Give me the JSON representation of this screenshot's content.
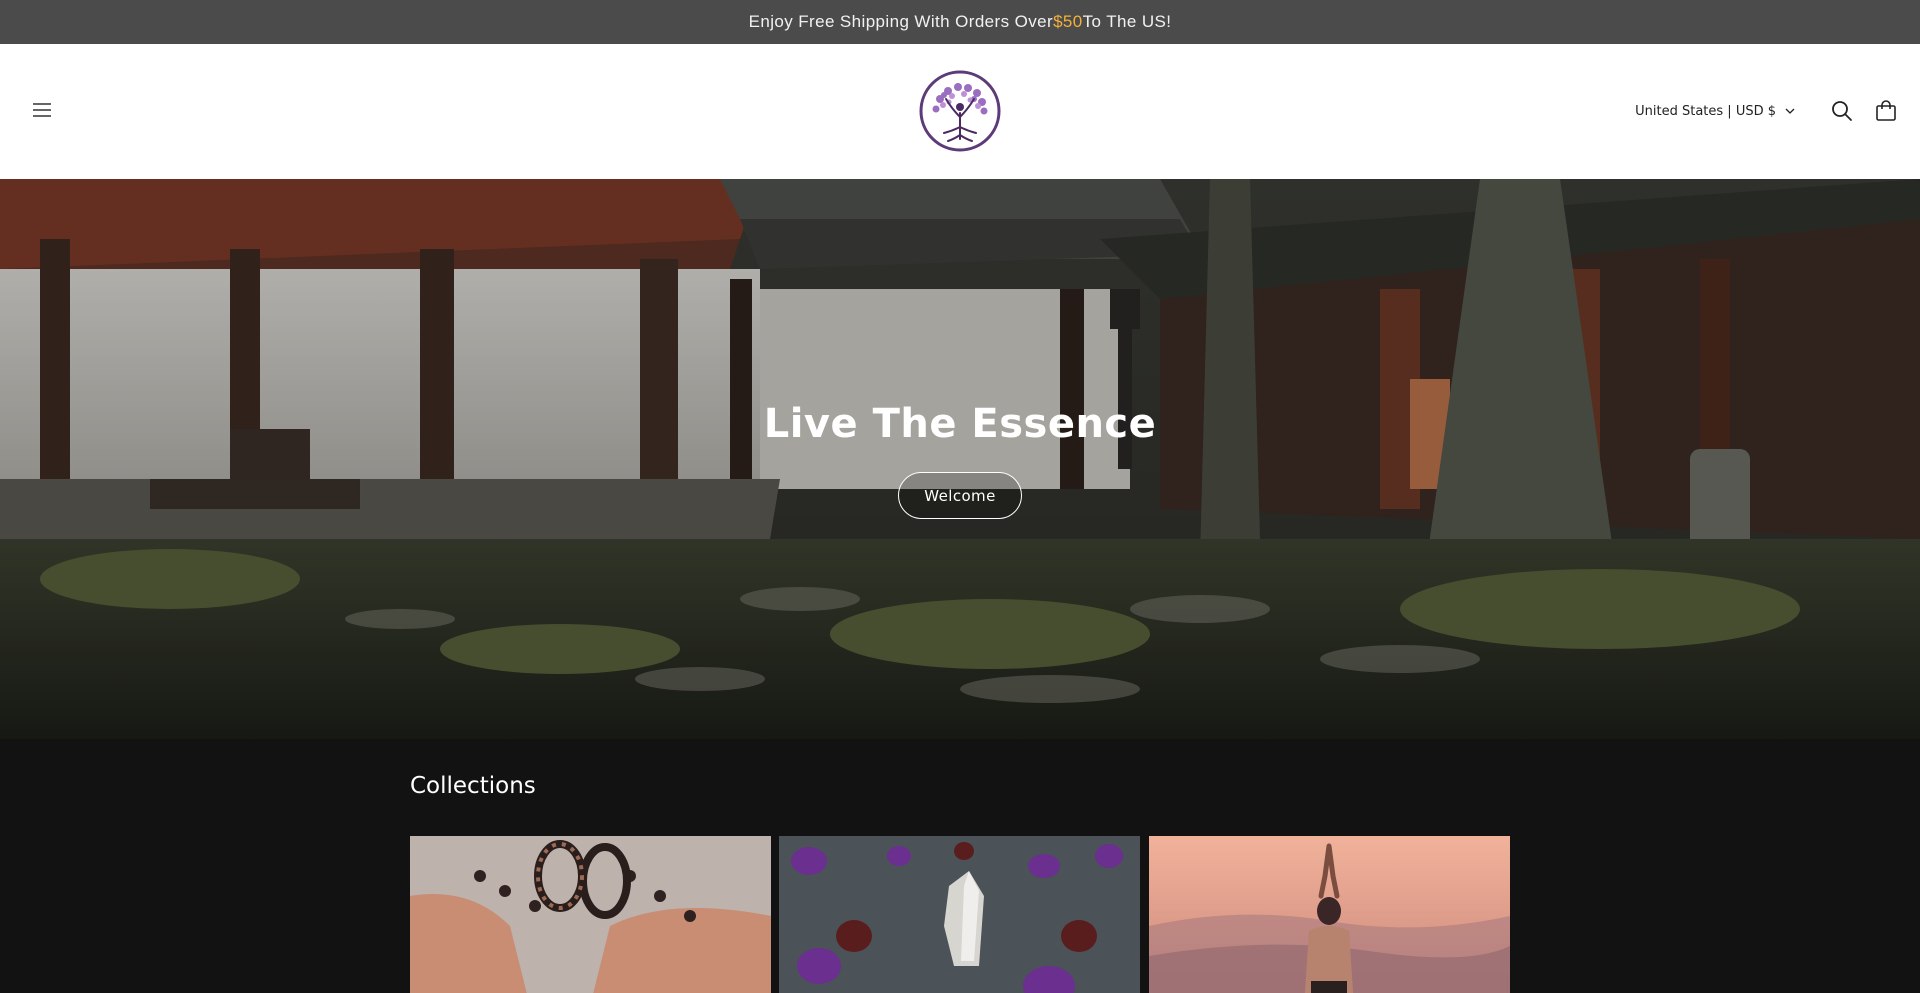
{
  "announcement": {
    "text_before": "Enjoy Free Shipping With Orders Over ",
    "highlight": "$50",
    "text_after": " To The US!",
    "highlight_color": "#f3b03b"
  },
  "header": {
    "menu_icon": "hamburger-menu-icon",
    "logo_alt": "tree-of-life-logo",
    "locale_label": "United States | USD $",
    "locale_chevron_icon": "chevron-down-icon",
    "search_icon": "search-icon",
    "cart_icon": "cart-bag-icon"
  },
  "hero": {
    "title": "Live The Essence",
    "button_label": "Welcome"
  },
  "collections": {
    "title": "Collections",
    "cards": [
      {
        "image": "hands-bracelets-image"
      },
      {
        "image": "crystals-gemstones-image"
      },
      {
        "image": "yoga-sunset-image"
      }
    ]
  },
  "colors": {
    "announcement_bg": "#4b4b4b",
    "header_bg": "#ffffff",
    "collections_bg": "#121212",
    "logo_purple": "#5d3a78"
  }
}
